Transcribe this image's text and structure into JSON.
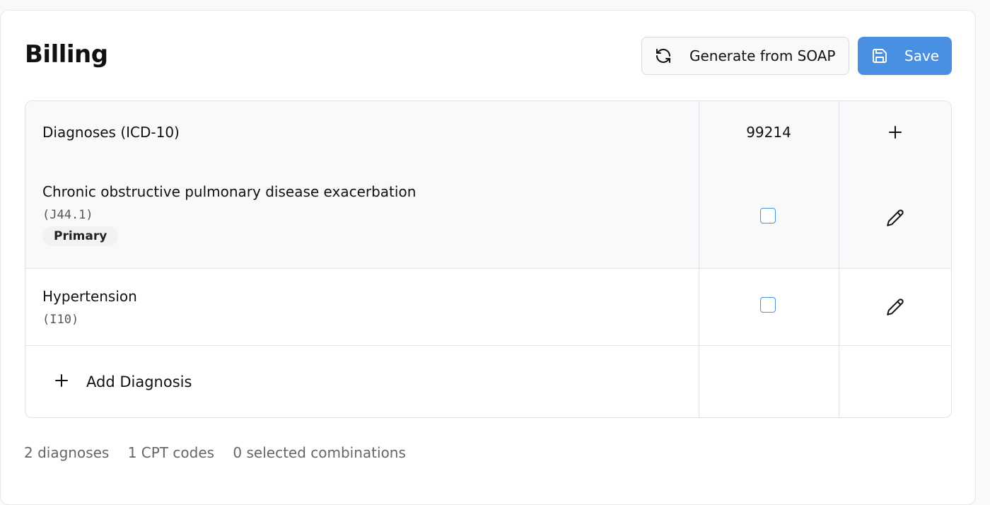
{
  "page": {
    "title": "Billing"
  },
  "toolbar": {
    "generate_label": "Generate from SOAP",
    "save_label": "Save",
    "generate_icon": "refresh-icon",
    "save_icon": "floppy-disk-icon"
  },
  "table": {
    "header_label": "Diagnoses (ICD-10)",
    "cpt_code": "99214",
    "add_cpt_icon": "plus-icon",
    "diagnoses": [
      {
        "name": "Chronic obstructive pulmonary disease exacerbation",
        "code": "(J44.1)",
        "badge": "Primary",
        "selected": false
      },
      {
        "name": "Hypertension",
        "code": "(I10)",
        "selected": false
      }
    ],
    "add_diagnosis_label": "Add Diagnosis"
  },
  "summary": {
    "diagnoses": "2 diagnoses",
    "cpt": "1 CPT codes",
    "combinations": "0 selected combinations"
  },
  "colors": {
    "accent": "#4a90e2",
    "row_bg": "#f8f9fb",
    "border": "#e1e3e8"
  }
}
